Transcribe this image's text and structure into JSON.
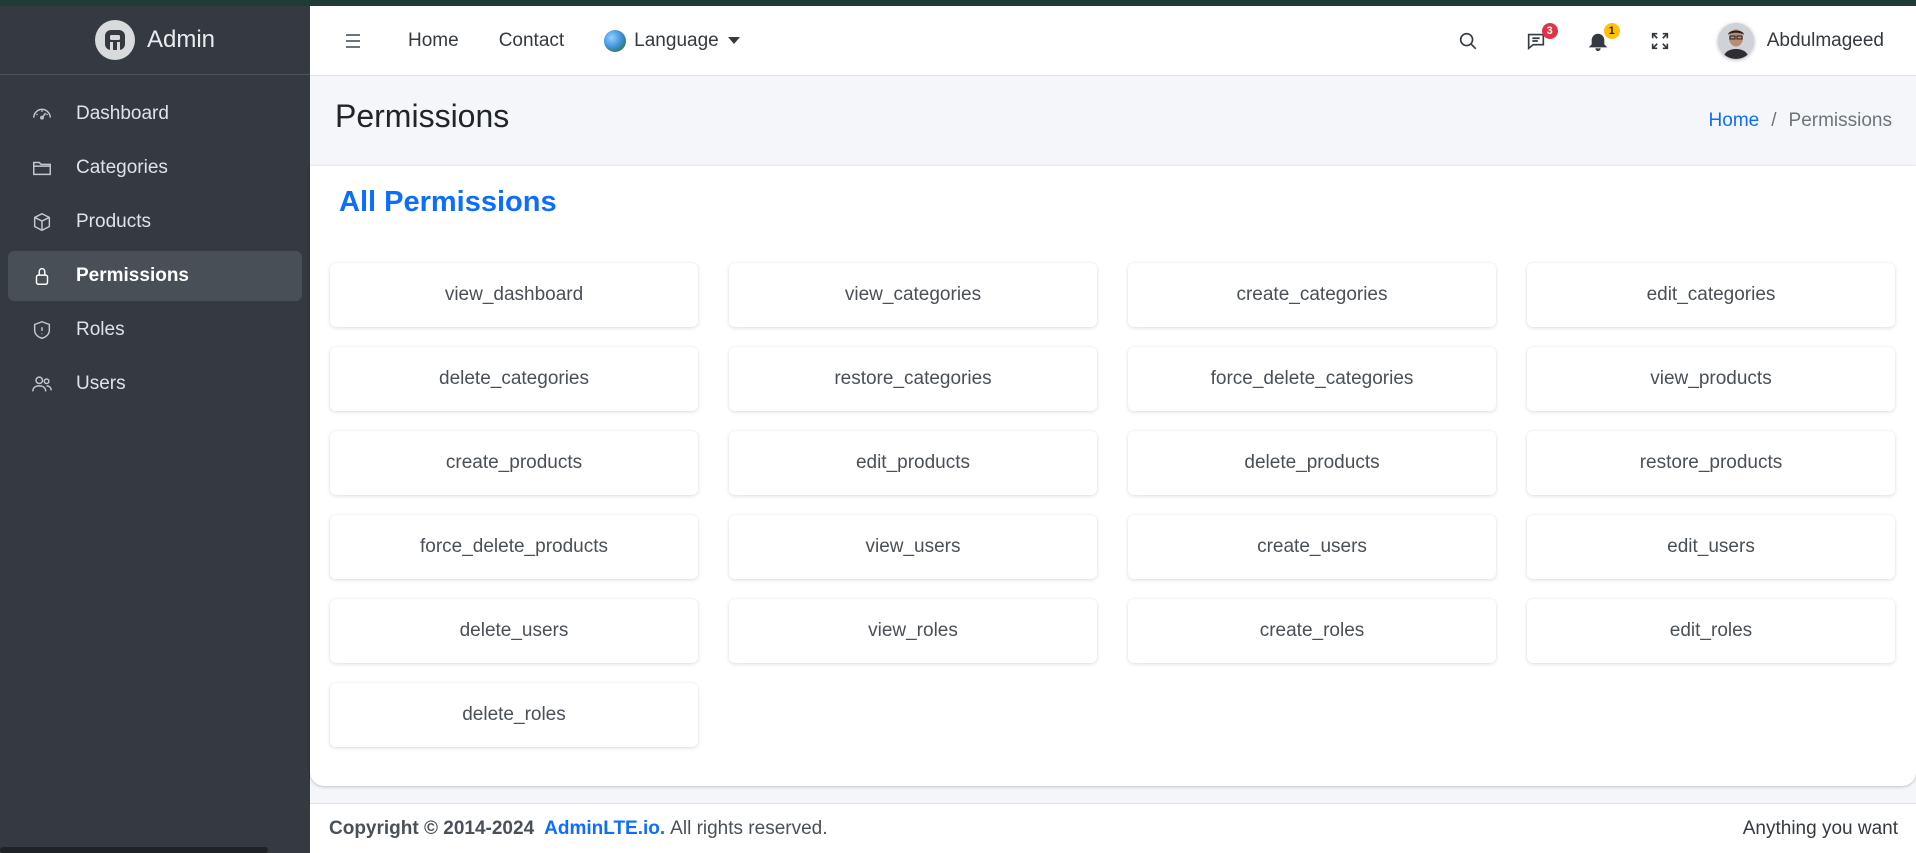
{
  "sidebar": {
    "brand": "Admin",
    "items": [
      {
        "label": "Dashboard",
        "icon": "speedometer-icon"
      },
      {
        "label": "Categories",
        "icon": "folder-icon"
      },
      {
        "label": "Products",
        "icon": "box-icon"
      },
      {
        "label": "Permissions",
        "icon": "lock-icon",
        "active": true
      },
      {
        "label": "Roles",
        "icon": "shield-icon"
      },
      {
        "label": "Users",
        "icon": "people-icon"
      }
    ]
  },
  "header": {
    "links": [
      "Home",
      "Contact"
    ],
    "language": "Language",
    "messages_count": "3",
    "notifications_count": "1",
    "user_name": "Abdulmageed"
  },
  "content": {
    "title": "Permissions",
    "breadcrumb": {
      "home": "Home",
      "separator": "/",
      "current": "Permissions"
    }
  },
  "card": {
    "title": "All Permissions",
    "permissions": [
      "view_dashboard",
      "view_categories",
      "create_categories",
      "edit_categories",
      "delete_categories",
      "restore_categories",
      "force_delete_categories",
      "view_products",
      "create_products",
      "edit_products",
      "delete_products",
      "restore_products",
      "force_delete_products",
      "view_users",
      "create_users",
      "edit_users",
      "delete_users",
      "view_roles",
      "create_roles",
      "edit_roles",
      "delete_roles"
    ]
  },
  "footer": {
    "copyright": "Copyright © 2014-2024",
    "brand": "AdminLTE.io.",
    "rights": "All rights reserved.",
    "right_text": "Anything you want"
  },
  "colors": {
    "sidebar_bg": "#343a40",
    "accent": "#0d6efd",
    "badge_red": "#dc3545",
    "badge_yellow": "#ffc107"
  }
}
